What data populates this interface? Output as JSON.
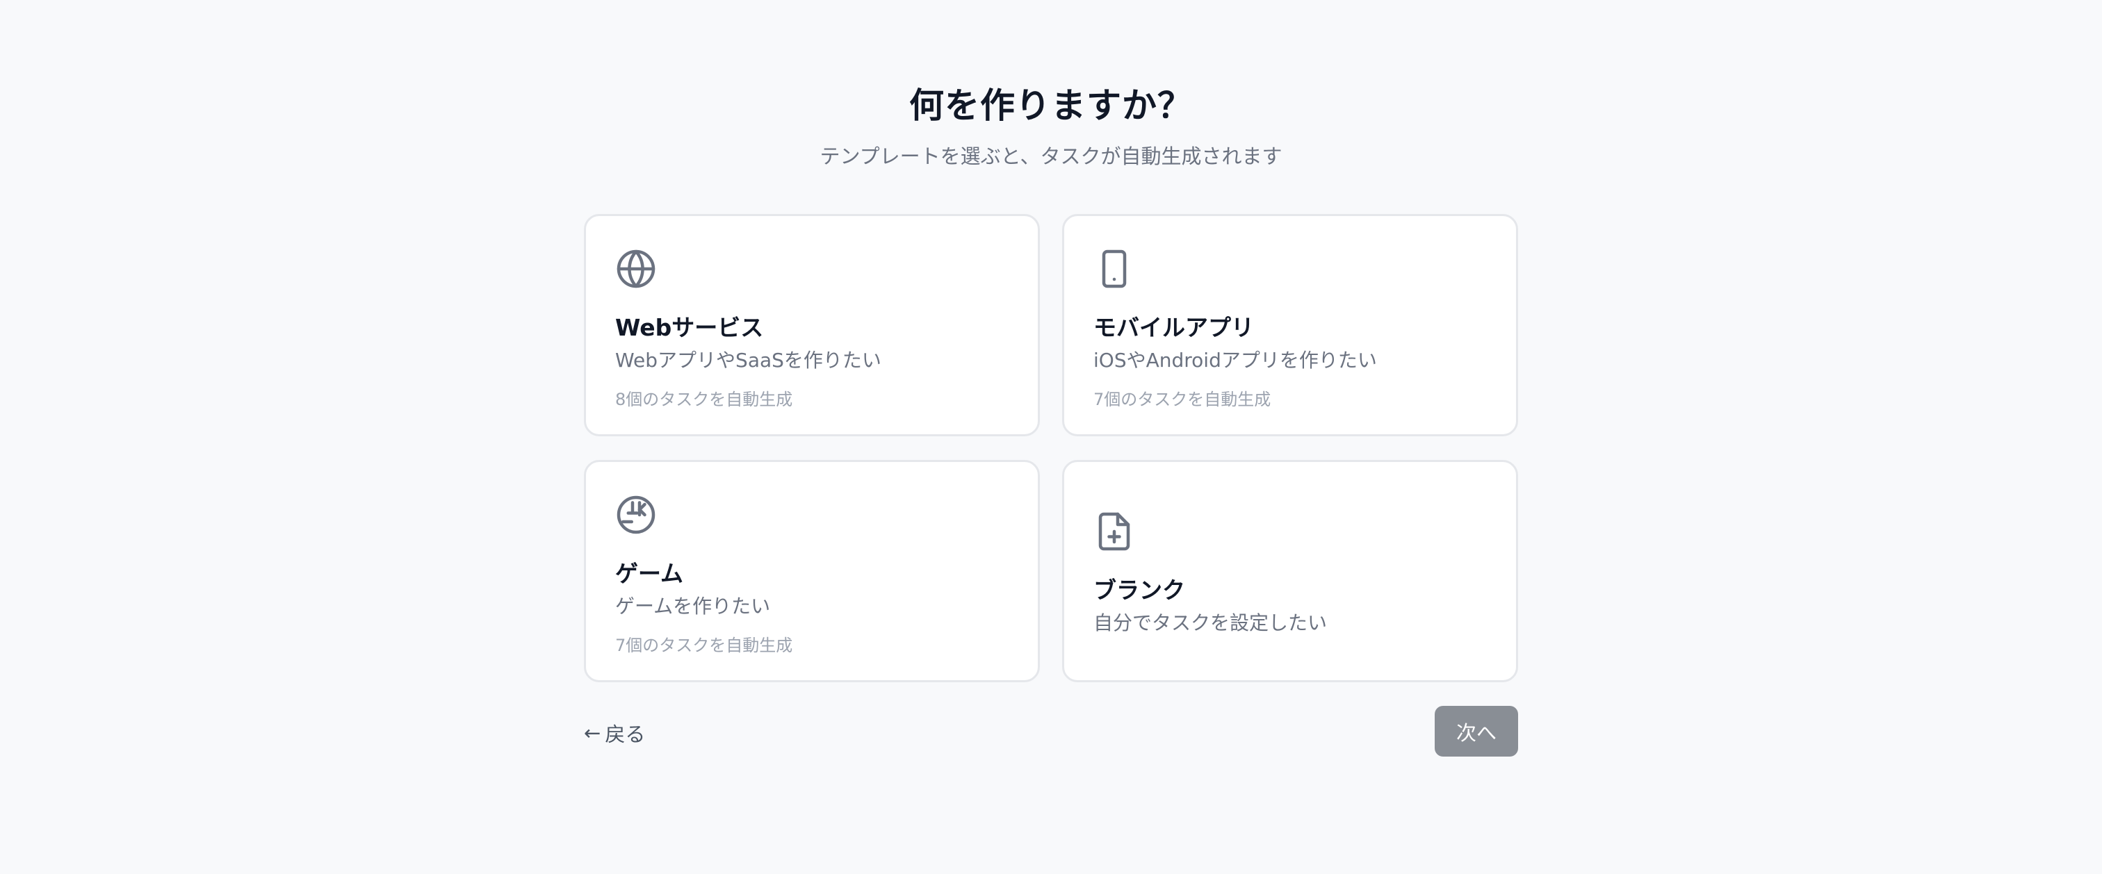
{
  "header": {
    "title": "何を作りますか？",
    "subtitle": "テンプレートを選ぶと、タスクが自動生成されます"
  },
  "templates": [
    {
      "icon": "globe-icon",
      "name": "Webサービス",
      "description": "WebアプリやSaaSを作りたい",
      "count": "8個のタスクを自動生成"
    },
    {
      "icon": "smartphone-icon",
      "name": "モバイルアプリ",
      "description": "iOSやAndroidアプリを作りたい",
      "count": "7個のタスクを自動生成"
    },
    {
      "icon": "game-icon",
      "name": "ゲーム",
      "description": "ゲームを作りたい",
      "count": "7個のタスクを自動生成"
    },
    {
      "icon": "file-plus-icon",
      "name": "ブランク",
      "description": "自分でタスクを設定したい"
    }
  ],
  "footer": {
    "back_arrow": "←",
    "back_label": "戻る",
    "next_label": "次へ"
  },
  "colors": {
    "background": "#f8f9fb",
    "card_border": "#e5e7eb",
    "next_button": "#898e95",
    "icon": "#6b7280"
  }
}
